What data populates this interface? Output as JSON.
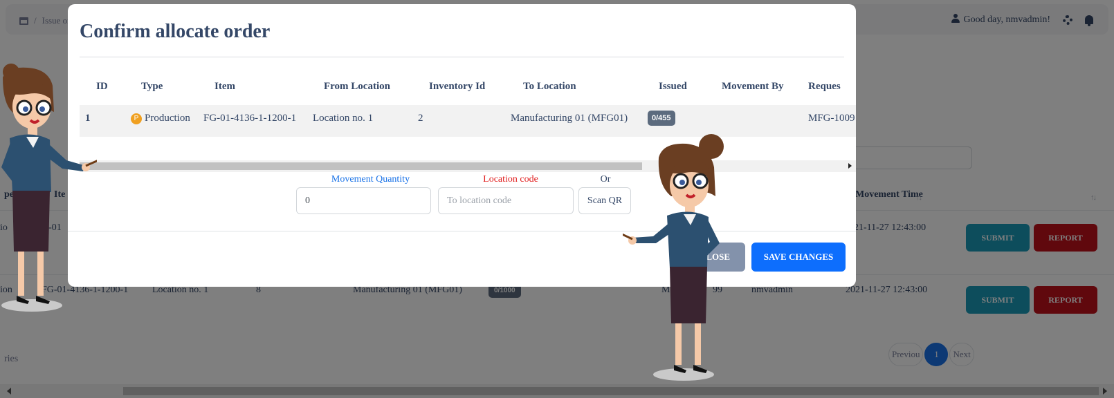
{
  "header": {
    "breadcrumb": "Issue orc",
    "greeting": "Good day, nmvadmin!"
  },
  "background_table": {
    "columns": [
      "pe",
      "Ite",
      "Movement Time"
    ],
    "rows": [
      {
        "type": "io",
        "item": "G-01",
        "time": "2021-11-27 12:43:00"
      },
      {
        "type": "ion",
        "item": "FG-01-4136-1-1200-1",
        "from": "Location no. 1",
        "inventory_id": "8",
        "to": "Manufacturing 01 (MFG01)",
        "issued": "0/1000",
        "request": "M",
        "request_tail": "99",
        "movement_by": "nmvadmin",
        "time": "2021-11-27 12:43:00"
      }
    ],
    "submit_label": "SUBMIT",
    "report_label": "REPORT",
    "footer_text": "ries",
    "pagination": {
      "previous": "Previou",
      "current": "1",
      "next": "Next"
    }
  },
  "modal": {
    "title": "Confirm allocate order",
    "columns": [
      "ID",
      "Type",
      "Item",
      "From Location",
      "Inventory Id",
      "To Location",
      "Issued",
      "Movement By",
      "Reques"
    ],
    "row": {
      "id": "1",
      "type_badge": "P",
      "type": "Production",
      "item": "FG-01-4136-1-1200-1",
      "from_location": "Location no. 1",
      "inventory_id": "2",
      "to_location": "Manufacturing 01 (MFG01)",
      "issued": "0/455",
      "movement_by": "",
      "request": "MFG-1009"
    },
    "form": {
      "movement_quantity_label": "Movement Quantity",
      "movement_quantity_value": "0",
      "location_code_label": "Location code",
      "location_code_placeholder": "To location code",
      "or_label": "Or",
      "scan_label": "Scan QR"
    },
    "close_label": "CLOSE",
    "save_label": "SAVE CHANGES"
  },
  "colors": {
    "accent_blue": "#0d6efd",
    "label_blue": "#1a73e8",
    "label_red": "#e11d1d",
    "submit": "#1a9ab8",
    "report": "#c0101a",
    "badge": "#5c6b7e"
  },
  "icons": [
    "store-icon",
    "user-icon",
    "gear-icon",
    "bell-icon",
    "production-badge-icon",
    "sort-icon"
  ]
}
